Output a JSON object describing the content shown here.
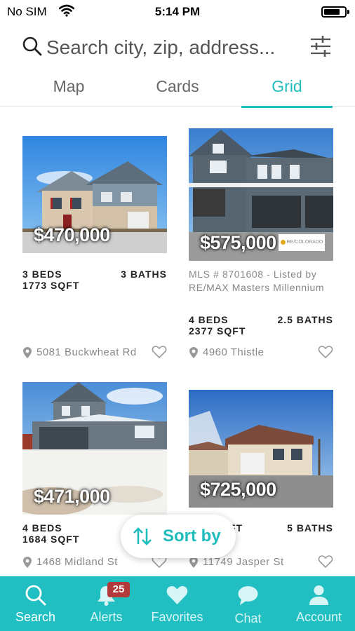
{
  "status_bar": {
    "carrier": "No SIM",
    "time": "5:14 PM"
  },
  "search": {
    "placeholder": "Search city, zip, address...",
    "icon": "search-icon",
    "filter_icon": "sliders-icon"
  },
  "tabs": [
    {
      "label": "Map",
      "active": false
    },
    {
      "label": "Cards",
      "active": false
    },
    {
      "label": "Grid",
      "active": true
    }
  ],
  "listings": [
    {
      "price": "$470,000",
      "beds": "3 BEDS",
      "baths": "3 BATHS",
      "sqft": "1773 SQFT",
      "address": "5081 Buckwheat Rd"
    },
    {
      "price": "$575,000",
      "mls": "MLS # 8701608 - Listed by RE/MAX Masters Millennium",
      "beds": "4 BEDS",
      "baths": "2.5 BATHS",
      "sqft": "2377 SQFT",
      "address": "4960 Thistle",
      "logo_text": "RE/COLORADO"
    },
    {
      "price": "$471,000",
      "beds": "4 BEDS",
      "baths": "",
      "sqft": "1684 SQFT",
      "address": "1468 Midland St"
    },
    {
      "price": "$725,000",
      "beds": "",
      "baths": "5 BATHS",
      "sqft": "FT",
      "address": "11749 Jasper St"
    }
  ],
  "sort_button": {
    "label": "Sort by",
    "icon": "sort-arrows-icon"
  },
  "bottom_nav": [
    {
      "label": "Search",
      "icon": "search-icon",
      "active": true
    },
    {
      "label": "Alerts",
      "icon": "bell-icon",
      "badge": "25"
    },
    {
      "label": "Favorites",
      "icon": "heart-icon"
    },
    {
      "label": "Chat",
      "icon": "chat-bubble-icon"
    },
    {
      "label": "Account",
      "icon": "person-icon"
    }
  ],
  "colors": {
    "accent": "#1fbcbc",
    "nav_background": "#22bfc2",
    "badge": "#b33a3a"
  }
}
